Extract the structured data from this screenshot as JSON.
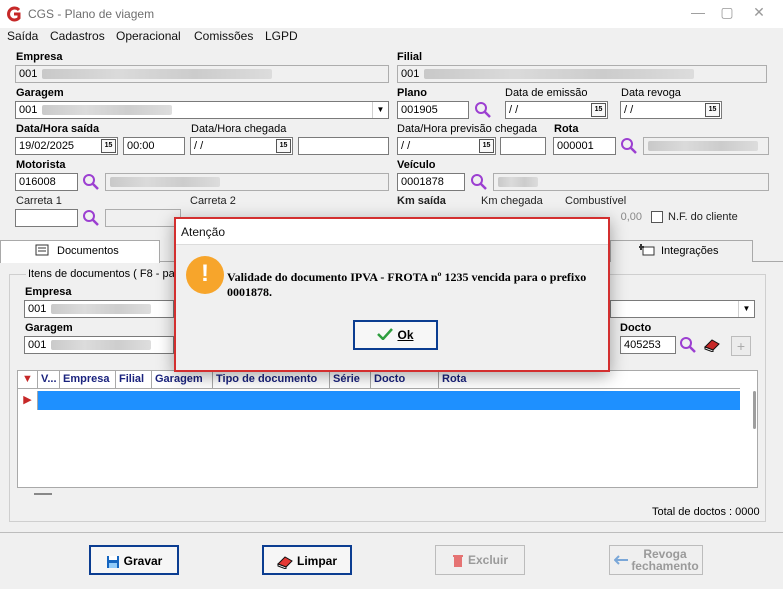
{
  "window": {
    "title": "CGS - Plano de viagem",
    "controls": [
      "—",
      "▢",
      "✕"
    ]
  },
  "menu": [
    "Saída",
    "Cadastros",
    "Operacional",
    "Comissões",
    "LGPD"
  ],
  "form": {
    "empresa_label": "Empresa",
    "empresa_value": "001",
    "filial_label": "Filial",
    "filial_value": "001",
    "garagem_label": "Garagem",
    "garagem_value": "001",
    "plano_label": "Plano",
    "plano_value": "001905",
    "data_emissao_label": "Data de emissão",
    "data_revoga_label": "Data revoga",
    "date_empty": " / /",
    "data_saida_label": "Data/Hora saída",
    "data_saida_value": "19/02/2025",
    "hora_saida_value": "00:00",
    "data_chegada_label": "Data/Hora chegada",
    "data_prev_label": "Data/Hora previsão chegada",
    "rota_label": "Rota",
    "rota_value": "000001",
    "motorista_label": "Motorista",
    "motorista_value": "016008",
    "veiculo_label": "Veículo",
    "veiculo_value": "0001878",
    "carreta1_label": "Carreta 1",
    "carreta2_label": "Carreta 2",
    "km_saida_label": "Km saída",
    "km_chegada_label": "Km chegada",
    "combustivel_label": "Combustível",
    "combustivel_value": "0,00",
    "nf_cliente_label": "N.F. do cliente"
  },
  "tabs": {
    "documentos": "Documentos",
    "integracoes": "Integrações"
  },
  "documents": {
    "group_label": "Itens de documentos ( F8 - par",
    "empresa_label": "Empresa",
    "empresa_value": "001",
    "garagem_label": "Garagem",
    "garagem_value": "001",
    "docto_label": "Docto",
    "docto_value": "405253",
    "columns": [
      "V...",
      "Empresa",
      "Filial",
      "Garagem",
      "Tipo de documento",
      "Série",
      "Docto",
      "Rota"
    ],
    "total_label": "Total de doctos : 0000"
  },
  "buttons": {
    "gravar": "Gravar",
    "limpar": "Limpar",
    "excluir": "Excluir",
    "revoga_line1": "Revoga",
    "revoga_line2": "fechamento"
  },
  "dialog": {
    "title": "Atenção",
    "icon": "!",
    "message": "Validade do documento IPVA - FROTA nº 1235 vencida para o prefixo 0001878.",
    "ok_label": "Ok"
  },
  "colors": {
    "accent": "#1e90ff",
    "dialog_border": "#d32f2f",
    "warning": "#f7a52b",
    "logo": "#c62828"
  }
}
